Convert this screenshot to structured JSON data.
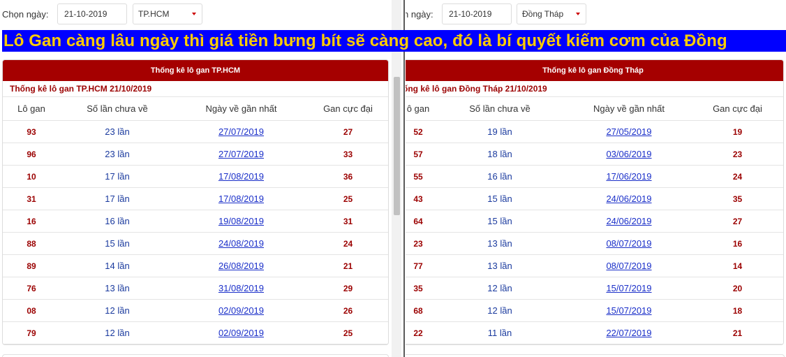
{
  "banner": {
    "text": "Lô Gan càng lâu ngày thì giá tiền bưng bít sẽ càng cao, đó là bí quyết kiếm cơm của Đồng"
  },
  "colors": {
    "header_bg": "#a50000",
    "banner_bg": "#0000ff",
    "banner_text": "#ffcc00",
    "link": "#1a2fc9"
  },
  "left": {
    "label": "Chọn ngày:",
    "date": "21-10-2019",
    "province": "TP.HCM",
    "title": "Thống kê lô gan TP.HCM",
    "subtitle": "Thống kê lô gan TP.HCM 21/10/2019",
    "columns": [
      "Lô gan",
      "Số lần chưa về",
      "Ngày về gần nhất",
      "Gan cực đại"
    ],
    "rows": [
      [
        "93",
        "23 lần",
        "27/07/2019",
        "27"
      ],
      [
        "96",
        "23 lần",
        "27/07/2019",
        "33"
      ],
      [
        "10",
        "17 lần",
        "17/08/2019",
        "36"
      ],
      [
        "31",
        "17 lần",
        "17/08/2019",
        "25"
      ],
      [
        "16",
        "16 lần",
        "19/08/2019",
        "31"
      ],
      [
        "88",
        "15 lần",
        "24/08/2019",
        "24"
      ],
      [
        "89",
        "14 lần",
        "26/08/2019",
        "21"
      ],
      [
        "76",
        "13 lần",
        "31/08/2019",
        "29"
      ],
      [
        "08",
        "12 lần",
        "02/09/2019",
        "26"
      ],
      [
        "79",
        "12 lần",
        "02/09/2019",
        "25"
      ]
    ]
  },
  "right": {
    "label": "n ngày:",
    "date": "21-10-2019",
    "province": "Đồng Tháp",
    "title": "Thống kê lô gan Đồng Tháp",
    "subtitle": "ống kê lô gan Đồng Tháp 21/10/2019",
    "columns": [
      "ô gan",
      "Số lần chưa về",
      "Ngày về gần nhất",
      "Gan cực đại"
    ],
    "rows": [
      [
        "52",
        "19 lần",
        "27/05/2019",
        "19"
      ],
      [
        "57",
        "18 lần",
        "03/06/2019",
        "23"
      ],
      [
        "55",
        "16 lần",
        "17/06/2019",
        "24"
      ],
      [
        "43",
        "15 lần",
        "24/06/2019",
        "35"
      ],
      [
        "64",
        "15 lần",
        "24/06/2019",
        "27"
      ],
      [
        "23",
        "13 lần",
        "08/07/2019",
        "16"
      ],
      [
        "77",
        "13 lần",
        "08/07/2019",
        "14"
      ],
      [
        "35",
        "12 lần",
        "15/07/2019",
        "20"
      ],
      [
        "68",
        "12 lần",
        "15/07/2019",
        "18"
      ],
      [
        "22",
        "11 lần",
        "22/07/2019",
        "21"
      ]
    ]
  }
}
